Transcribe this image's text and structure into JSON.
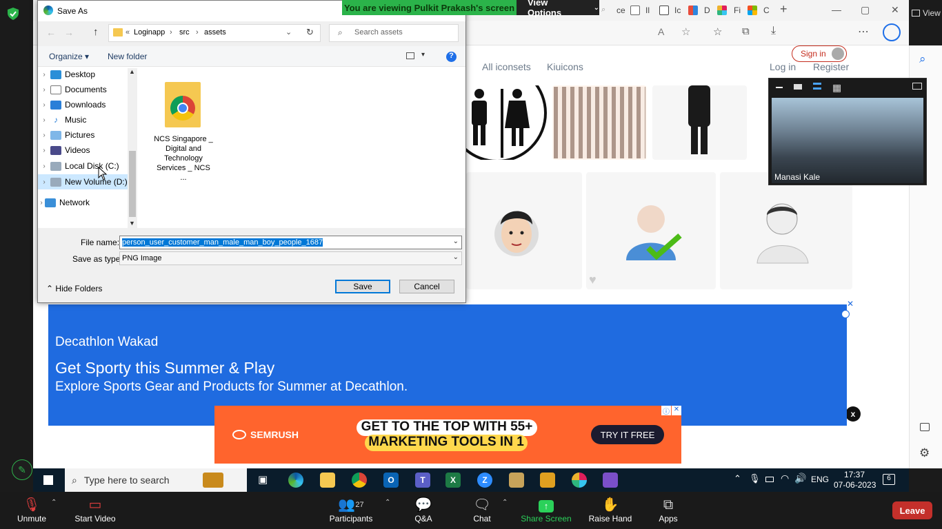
{
  "zoom": {
    "view_label": "View",
    "banner": "You are viewing Pulkit Prakash's screen",
    "view_options": "View Options",
    "participant_name": "Manasi Kale",
    "participants_count": "27",
    "bottom": {
      "unmute": "Unmute",
      "start_video": "Start Video",
      "participants": "Participants",
      "qa": "Q&A",
      "chat": "Chat",
      "share_screen": "Share Screen",
      "raise_hand": "Raise Hand",
      "apps": "Apps",
      "leave": "Leave"
    }
  },
  "browser": {
    "tabs_short": [
      "ce",
      "Il",
      "Ic",
      "D",
      "Fi",
      "C"
    ],
    "signin": "Sign in",
    "nav": {
      "all_iconsets": "All iconsets",
      "kiuicons": "Kiuicons",
      "login": "Log in",
      "register": "Register"
    },
    "ad1": {
      "brand": "Decathlon Wakad",
      "headline": "Get Sporty this Summer & Play",
      "sub": "Explore Sports Gear and Products for Summer at Decathlon."
    },
    "ad2": {
      "brand": "SEMRUSH",
      "line1": "GET TO THE TOP WITH 55+",
      "line2": "MARKETING TOOLS IN 1",
      "cta": "TRY IT FREE"
    },
    "close_x": "x"
  },
  "dialog": {
    "title": "Save As",
    "breadcrumb": [
      "Loginapp",
      "src",
      "assets"
    ],
    "search_placeholder": "Search assets",
    "organize": "Organize",
    "new_folder": "New folder",
    "nav_items": [
      "Desktop",
      "Documents",
      "Downloads",
      "Music",
      "Pictures",
      "Videos",
      "Local Disk (C:)",
      "New Volume (D:)",
      "Network"
    ],
    "file": {
      "name": "NCS Singapore _ Digital and Technology Services _ NCS ..."
    },
    "file_name_label": "File name:",
    "file_name_value": "person_user_customer_man_male_man_boy_people_1687",
    "save_type_label": "Save as type:",
    "save_type_value": "PNG Image",
    "hide_folders": "Hide Folders",
    "save": "Save",
    "cancel": "Cancel"
  },
  "taskbar": {
    "search_placeholder": "Type here to search",
    "lang": "ENG",
    "time": "17:37",
    "date": "07-06-2023",
    "notif_count": "6"
  }
}
